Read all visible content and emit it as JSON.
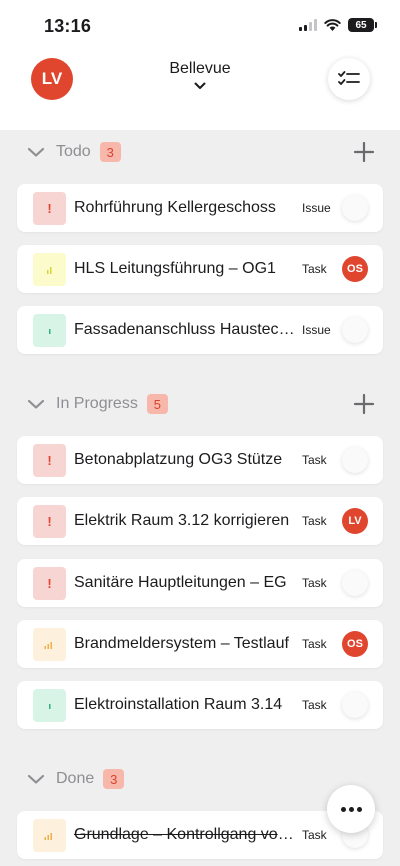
{
  "status_bar": {
    "time": "13:16",
    "battery": "65"
  },
  "header": {
    "user_initials": "LV",
    "project_name": "Bellevue",
    "checklist_icon": "checklist-icon"
  },
  "sections": [
    {
      "title": "Todo",
      "count": "3",
      "items": [
        {
          "title": "Rohrführung Kellergeschoss",
          "type": "Issue",
          "priority": "high",
          "assignee": ""
        },
        {
          "title": "HLS Leitungsführung – OG1",
          "type": "Task",
          "priority": "yellow",
          "assignee": "OS"
        },
        {
          "title": "Fassadenanschluss Haustechnik",
          "type": "Issue",
          "priority": "low",
          "assignee": ""
        }
      ]
    },
    {
      "title": "In Progress",
      "count": "5",
      "items": [
        {
          "title": "Betonabplatzung OG3 Stütze",
          "type": "Task",
          "priority": "high",
          "assignee": ""
        },
        {
          "title": "Elektrik Raum 3.12 korrigieren",
          "type": "Task",
          "priority": "high",
          "assignee": "LV"
        },
        {
          "title": "Sanitäre Hauptleitungen – EG",
          "type": "Task",
          "priority": "high",
          "assignee": ""
        },
        {
          "title": "Brandmeldersystem – Testlauf",
          "type": "Task",
          "priority": "medium",
          "assignee": "OS"
        },
        {
          "title": "Elektroinstallation Raum 3.14",
          "type": "Task",
          "priority": "low",
          "assignee": ""
        }
      ]
    },
    {
      "title": "Done",
      "count": "3",
      "items": [
        {
          "title": "Grundlage – Kontrollgang vor Ort",
          "type": "Task",
          "priority": "medium",
          "assignee": "",
          "done": true
        }
      ]
    }
  ],
  "colors": {
    "accent": "#e0452e",
    "badge_bg": "#f7b7aa",
    "background": "#efefef"
  }
}
